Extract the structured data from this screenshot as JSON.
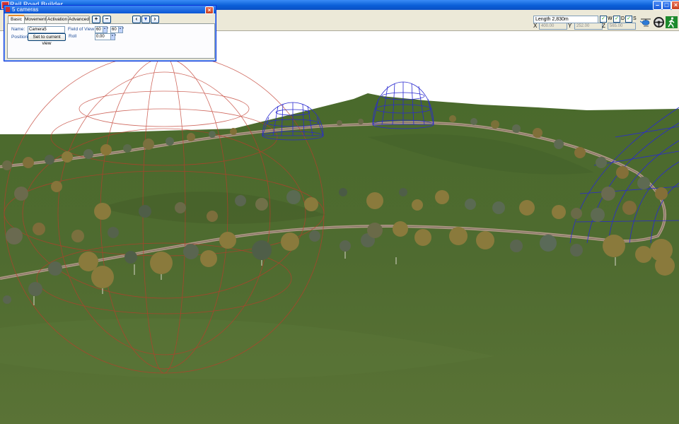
{
  "window": {
    "title": "Rail Road Builder"
  },
  "dialog": {
    "title": "5 cameras",
    "tabs": [
      {
        "label": "Basic",
        "active": true
      },
      {
        "label": "Movement",
        "active": false
      },
      {
        "label": "Activation",
        "active": false
      },
      {
        "label": "Advanced",
        "active": false
      }
    ],
    "name_label": "Name:",
    "name_value": "Camera5",
    "fov_label": "Field of View",
    "fov_value_1": "60",
    "fov_value_2": "60",
    "position_label": "Position:",
    "set_view_button": "Set to current view",
    "roll_label": "Roll",
    "roll_value": "0.00"
  },
  "toolbar": {
    "length_label": "Length 2,830m",
    "checks": [
      {
        "label": "W",
        "checked": true
      },
      {
        "label": "D",
        "checked": true
      },
      {
        "label": "S",
        "checked": true
      }
    ],
    "coords": [
      {
        "label": "X",
        "value": "400.00"
      },
      {
        "label": "Y",
        "value": "252.00"
      },
      {
        "label": "Z",
        "value": "565.00"
      }
    ]
  },
  "colors": {
    "grass": "#4f6b30",
    "track": "#b09a86",
    "red_wire": "#c0392b",
    "blue_wire": "#2a2ad0"
  },
  "icons": [
    "helicopter-icon",
    "steering-wheel-icon",
    "walking-person-icon"
  ]
}
